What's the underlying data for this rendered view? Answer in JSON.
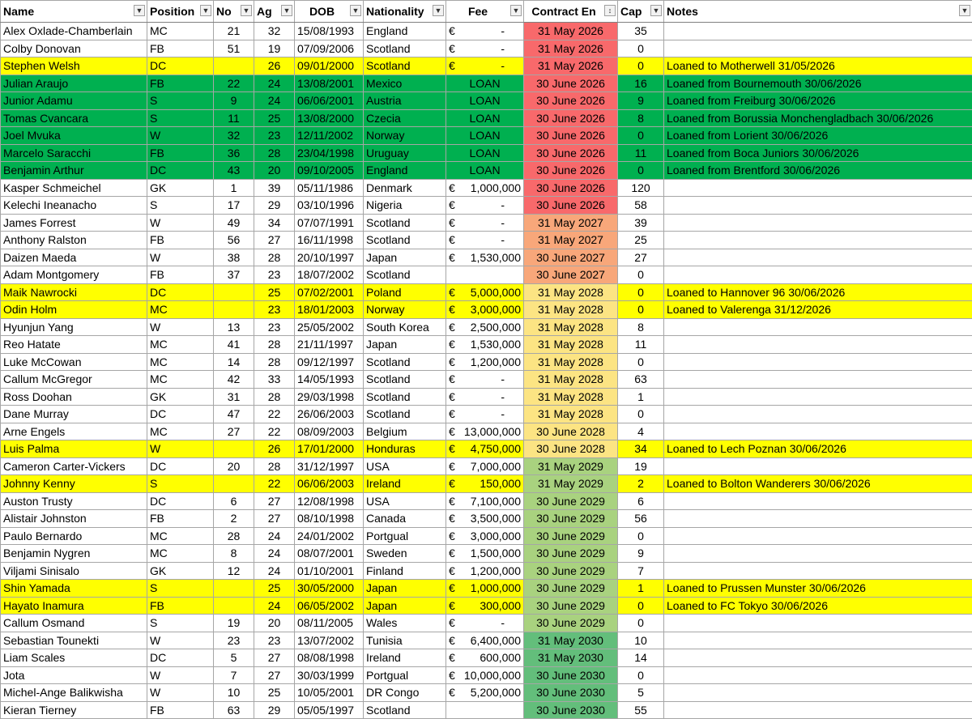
{
  "headers": {
    "name": "Name",
    "position": "Position",
    "no": "No",
    "age": "Ag",
    "dob": "DOB",
    "nationality": "Nationality",
    "fee": "Fee",
    "contract": "Contract En",
    "caps": "Cap",
    "notes": "Notes"
  },
  "icons": {
    "filter": "dropdown-arrow-icon",
    "sorted_filter": "sort-filter-icon"
  },
  "currency": "€",
  "colors": {
    "loaned_out": "#ffff00",
    "loaned_in": "#00b050",
    "contract_2026": "#f8696b",
    "contract_2027": "#f8a77a",
    "contract_2028": "#fce483",
    "contract_2029": "#a9d27f",
    "contract_2030": "#63be7b"
  },
  "rows": [
    {
      "name": "Alex Oxlade-Chamberlain",
      "pos": "MC",
      "no": "21",
      "age": "32",
      "dob": "15/08/1993",
      "nat": "England",
      "fee": "-",
      "contract": "31 May 2026",
      "caps": "35",
      "notes": "",
      "style": ""
    },
    {
      "name": "Colby Donovan",
      "pos": "FB",
      "no": "51",
      "age": "19",
      "dob": "07/09/2006",
      "nat": "Scotland",
      "fee": "-",
      "contract": "31 May 2026",
      "caps": "0",
      "notes": "",
      "style": ""
    },
    {
      "name": "Stephen Welsh",
      "pos": "DC",
      "no": "",
      "age": "26",
      "dob": "09/01/2000",
      "nat": "Scotland",
      "fee": "-",
      "contract": "31 May 2026",
      "caps": "0",
      "notes": "Loaned to Motherwell 31/05/2026",
      "style": "yellow"
    },
    {
      "name": "Julian Araujo",
      "pos": "FB",
      "no": "22",
      "age": "24",
      "dob": "13/08/2001",
      "nat": "Mexico",
      "fee": "LOAN",
      "contract": "30 June 2026",
      "caps": "16",
      "notes": "Loaned from Bournemouth 30/06/2026",
      "style": "green"
    },
    {
      "name": "Junior Adamu",
      "pos": "S",
      "no": "9",
      "age": "24",
      "dob": "06/06/2001",
      "nat": "Austria",
      "fee": "LOAN",
      "contract": "30 June 2026",
      "caps": "9",
      "notes": "Loaned from Freiburg 30/06/2026",
      "style": "green"
    },
    {
      "name": "Tomas Cvancara",
      "pos": "S",
      "no": "11",
      "age": "25",
      "dob": "13/08/2000",
      "nat": "Czecia",
      "fee": "LOAN",
      "contract": "30 June 2026",
      "caps": "8",
      "notes": "Loaned from Borussia Monchengladbach 30/06/2026",
      "style": "green"
    },
    {
      "name": "Joel Mvuka",
      "pos": "W",
      "no": "32",
      "age": "23",
      "dob": "12/11/2002",
      "nat": "Norway",
      "fee": "LOAN",
      "contract": "30 June 2026",
      "caps": "0",
      "notes": "Loaned from Lorient 30/06/2026",
      "style": "green"
    },
    {
      "name": "Marcelo Saracchi",
      "pos": "FB",
      "no": "36",
      "age": "28",
      "dob": "23/04/1998",
      "nat": "Uruguay",
      "fee": "LOAN",
      "contract": "30 June 2026",
      "caps": "11",
      "notes": "Loaned from Boca Juniors 30/06/2026",
      "style": "green"
    },
    {
      "name": "Benjamin Arthur",
      "pos": "DC",
      "no": "43",
      "age": "20",
      "dob": "09/10/2005",
      "nat": "England",
      "fee": "LOAN",
      "contract": "30 June 2026",
      "caps": "0",
      "notes": "Loaned from Brentford 30/06/2026",
      "style": "green"
    },
    {
      "name": "Kasper Schmeichel",
      "pos": "GK",
      "no": "1",
      "age": "39",
      "dob": "05/11/1986",
      "nat": "Denmark",
      "fee": "1,000,000",
      "contract": "30 June 2026",
      "caps": "120",
      "notes": "",
      "style": ""
    },
    {
      "name": "Kelechi Ineanacho",
      "pos": "S",
      "no": "17",
      "age": "29",
      "dob": "03/10/1996",
      "nat": "Nigeria",
      "fee": "-",
      "contract": "30 June 2026",
      "caps": "58",
      "notes": "",
      "style": ""
    },
    {
      "name": "James Forrest",
      "pos": "W",
      "no": "49",
      "age": "34",
      "dob": "07/07/1991",
      "nat": "Scotland",
      "fee": "-",
      "contract": "31 May 2027",
      "caps": "39",
      "notes": "",
      "style": ""
    },
    {
      "name": "Anthony Ralston",
      "pos": "FB",
      "no": "56",
      "age": "27",
      "dob": "16/11/1998",
      "nat": "Scotland",
      "fee": "-",
      "contract": "31 May 2027",
      "caps": "25",
      "notes": "",
      "style": ""
    },
    {
      "name": "Daizen Maeda",
      "pos": "W",
      "no": "38",
      "age": "28",
      "dob": "20/10/1997",
      "nat": "Japan",
      "fee": "1,530,000",
      "contract": "30 June 2027",
      "caps": "27",
      "notes": "",
      "style": ""
    },
    {
      "name": "Adam Montgomery",
      "pos": "FB",
      "no": "37",
      "age": "23",
      "dob": "18/07/2002",
      "nat": "Scotland",
      "fee": "",
      "contract": "30 June 2027",
      "caps": "0",
      "notes": "",
      "style": ""
    },
    {
      "name": "Maik Nawrocki",
      "pos": "DC",
      "no": "",
      "age": "25",
      "dob": "07/02/2001",
      "nat": "Poland",
      "fee": "5,000,000",
      "contract": "31 May 2028",
      "caps": "0",
      "notes": "Loaned to Hannover 96 30/06/2026",
      "style": "yellow"
    },
    {
      "name": "Odin Holm",
      "pos": "MC",
      "no": "",
      "age": "23",
      "dob": "18/01/2003",
      "nat": "Norway",
      "fee": "3,000,000",
      "contract": "31 May 2028",
      "caps": "0",
      "notes": "Loaned to Valerenga 31/12/2026",
      "style": "yellow"
    },
    {
      "name": "Hyunjun Yang",
      "pos": "W",
      "no": "13",
      "age": "23",
      "dob": "25/05/2002",
      "nat": "South Korea",
      "fee": "2,500,000",
      "contract": "31 May 2028",
      "caps": "8",
      "notes": "",
      "style": ""
    },
    {
      "name": "Reo Hatate",
      "pos": "MC",
      "no": "41",
      "age": "28",
      "dob": "21/11/1997",
      "nat": "Japan",
      "fee": "1,530,000",
      "contract": "31 May 2028",
      "caps": "11",
      "notes": "",
      "style": ""
    },
    {
      "name": "Luke McCowan",
      "pos": "MC",
      "no": "14",
      "age": "28",
      "dob": "09/12/1997",
      "nat": "Scotland",
      "fee": "1,200,000",
      "contract": "31 May 2028",
      "caps": "0",
      "notes": "",
      "style": ""
    },
    {
      "name": "Callum McGregor",
      "pos": "MC",
      "no": "42",
      "age": "33",
      "dob": "14/05/1993",
      "nat": "Scotland",
      "fee": "-",
      "contract": "31 May 2028",
      "caps": "63",
      "notes": "",
      "style": ""
    },
    {
      "name": "Ross Doohan",
      "pos": "GK",
      "no": "31",
      "age": "28",
      "dob": "29/03/1998",
      "nat": "Scotland",
      "fee": "-",
      "contract": "31 May 2028",
      "caps": "1",
      "notes": "",
      "style": ""
    },
    {
      "name": "Dane Murray",
      "pos": "DC",
      "no": "47",
      "age": "22",
      "dob": "26/06/2003",
      "nat": "Scotland",
      "fee": "-",
      "contract": "31 May 2028",
      "caps": "0",
      "notes": "",
      "style": ""
    },
    {
      "name": "Arne Engels",
      "pos": "MC",
      "no": "27",
      "age": "22",
      "dob": "08/09/2003",
      "nat": "Belgium",
      "fee": "13,000,000",
      "contract": "30 June 2028",
      "caps": "4",
      "notes": "",
      "style": ""
    },
    {
      "name": "Luis Palma",
      "pos": "W",
      "no": "",
      "age": "26",
      "dob": "17/01/2000",
      "nat": "Honduras",
      "fee": "4,750,000",
      "contract": "30 June 2028",
      "caps": "34",
      "notes": "Loaned to Lech Poznan 30/06/2026",
      "style": "yellow"
    },
    {
      "name": "Cameron Carter-Vickers",
      "pos": "DC",
      "no": "20",
      "age": "28",
      "dob": "31/12/1997",
      "nat": "USA",
      "fee": "7,000,000",
      "contract": "31 May 2029",
      "caps": "19",
      "notes": "",
      "style": ""
    },
    {
      "name": "Johnny Kenny",
      "pos": "S",
      "no": "",
      "age": "22",
      "dob": "06/06/2003",
      "nat": "Ireland",
      "fee": "150,000",
      "contract": "31 May 2029",
      "caps": "2",
      "notes": "Loaned to Bolton Wanderers 30/06/2026",
      "style": "yellow"
    },
    {
      "name": "Auston Trusty",
      "pos": "DC",
      "no": "6",
      "age": "27",
      "dob": "12/08/1998",
      "nat": "USA",
      "fee": "7,100,000",
      "contract": "30 June 2029",
      "caps": "6",
      "notes": "",
      "style": ""
    },
    {
      "name": "Alistair Johnston",
      "pos": "FB",
      "no": "2",
      "age": "27",
      "dob": "08/10/1998",
      "nat": "Canada",
      "fee": "3,500,000",
      "contract": "30 June 2029",
      "caps": "56",
      "notes": "",
      "style": ""
    },
    {
      "name": "Paulo Bernardo",
      "pos": "MC",
      "no": "28",
      "age": "24",
      "dob": "24/01/2002",
      "nat": "Portgual",
      "fee": "3,000,000",
      "contract": "30 June 2029",
      "caps": "0",
      "notes": "",
      "style": ""
    },
    {
      "name": "Benjamin Nygren",
      "pos": "MC",
      "no": "8",
      "age": "24",
      "dob": "08/07/2001",
      "nat": "Sweden",
      "fee": "1,500,000",
      "contract": "30 June 2029",
      "caps": "9",
      "notes": "",
      "style": ""
    },
    {
      "name": "Viljami Sinisalo",
      "pos": "GK",
      "no": "12",
      "age": "24",
      "dob": "01/10/2001",
      "nat": "Finland",
      "fee": "1,200,000",
      "contract": "30 June 2029",
      "caps": "7",
      "notes": "",
      "style": ""
    },
    {
      "name": "Shin Yamada",
      "pos": "S",
      "no": "",
      "age": "25",
      "dob": "30/05/2000",
      "nat": "Japan",
      "fee": "1,000,000",
      "contract": "30 June 2029",
      "caps": "1",
      "notes": "Loaned to Prussen Munster 30/06/2026",
      "style": "yellow"
    },
    {
      "name": "Hayato Inamura",
      "pos": "FB",
      "no": "",
      "age": "24",
      "dob": "06/05/2002",
      "nat": "Japan",
      "fee": "300,000",
      "contract": "30 June 2029",
      "caps": "0",
      "notes": "Loaned to FC Tokyo 30/06/2026",
      "style": "yellow"
    },
    {
      "name": "Callum Osmand",
      "pos": "S",
      "no": "19",
      "age": "20",
      "dob": "08/11/2005",
      "nat": "Wales",
      "fee": "-",
      "contract": "30 June 2029",
      "caps": "0",
      "notes": "",
      "style": ""
    },
    {
      "name": "Sebastian Tounekti",
      "pos": "W",
      "no": "23",
      "age": "23",
      "dob": "13/07/2002",
      "nat": "Tunisia",
      "fee": "6,400,000",
      "contract": "31 May 2030",
      "caps": "10",
      "notes": "",
      "style": ""
    },
    {
      "name": "Liam Scales",
      "pos": "DC",
      "no": "5",
      "age": "27",
      "dob": "08/08/1998",
      "nat": "Ireland",
      "fee": "600,000",
      "contract": "31 May 2030",
      "caps": "14",
      "notes": "",
      "style": ""
    },
    {
      "name": "Jota",
      "pos": "W",
      "no": "7",
      "age": "27",
      "dob": "30/03/1999",
      "nat": "Portgual",
      "fee": "10,000,000",
      "contract": "30 June 2030",
      "caps": "0",
      "notes": "",
      "style": ""
    },
    {
      "name": "Michel-Ange Balikwisha",
      "pos": "W",
      "no": "10",
      "age": "25",
      "dob": "10/05/2001",
      "nat": "DR Congo",
      "fee": "5,200,000",
      "contract": "30 June 2030",
      "caps": "5",
      "notes": "",
      "style": ""
    },
    {
      "name": "Kieran Tierney",
      "pos": "FB",
      "no": "63",
      "age": "29",
      "dob": "05/05/1997",
      "nat": "Scotland",
      "fee": "",
      "contract": "30 June 2030",
      "caps": "55",
      "notes": "",
      "style": ""
    }
  ]
}
